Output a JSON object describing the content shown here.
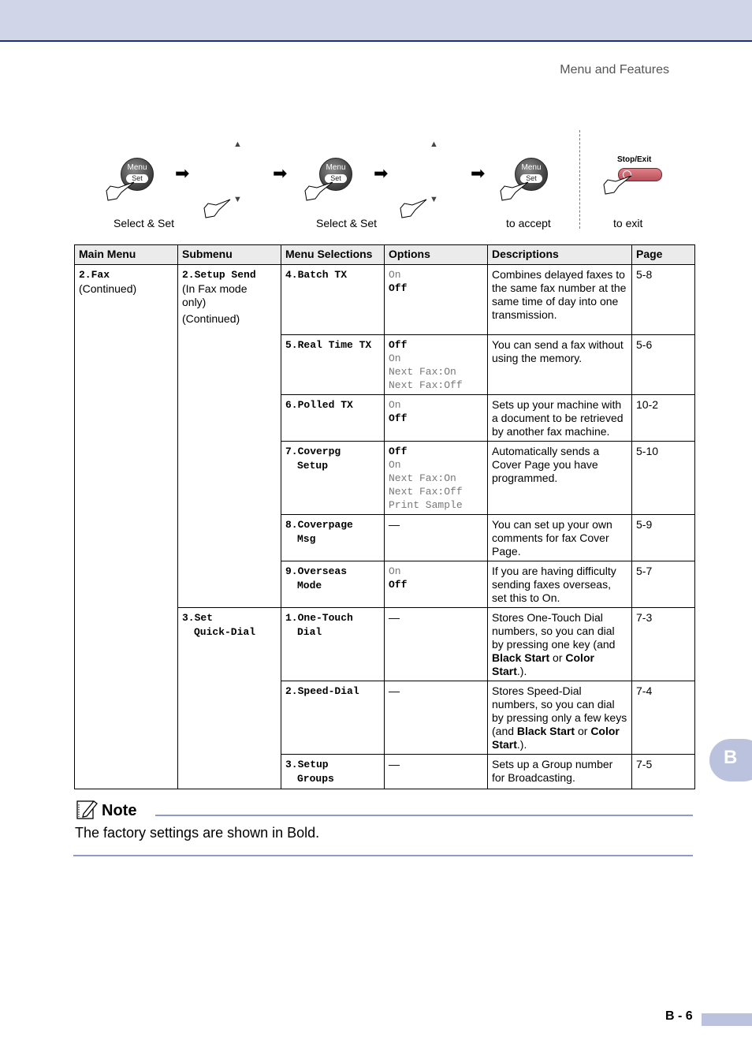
{
  "header": {
    "section_title": "Menu and Features",
    "accent_color": "#1b2f86",
    "band_color": "#d0d6e8"
  },
  "diagram": {
    "menu_button": {
      "top": "Menu",
      "bottom": "Set"
    },
    "steps": [
      {
        "caption": "Select & Set"
      },
      {
        "caption": "Select & Set"
      },
      {
        "caption": "to accept"
      },
      {
        "caption": "to exit"
      }
    ],
    "stop_label": "Stop/Exit",
    "up_icon": "▲",
    "down_icon": "▼",
    "arrow_icon": "➡"
  },
  "table": {
    "headers": [
      "Main Menu",
      "Submenu",
      "Menu Selections",
      "Options",
      "Descriptions",
      "Page"
    ],
    "main_menu": {
      "code_num": "2.",
      "code_label": "Fax",
      "note": "(Continued)"
    },
    "submenus": [
      {
        "code_num": "2.",
        "code_label": "Setup Send",
        "lines": [
          "(In Fax mode only)",
          "(Continued)"
        ]
      },
      {
        "code_num": "3.",
        "code_label": "Set",
        "code_label2": "Quick-Dial"
      }
    ],
    "rows": [
      {
        "sel_num": "4.",
        "sel_l1": "Batch TX",
        "sel_l2": "",
        "options": [
          {
            "t": "On",
            "b": false
          },
          {
            "t": "Off",
            "b": true
          }
        ],
        "desc": "Combines delayed faxes to the same fax number at the same time of day into one transmission.",
        "page": "5-8"
      },
      {
        "sel_num": "5.",
        "sel_l1": "Real Time TX",
        "sel_l2": "",
        "options": [
          {
            "t": "Off",
            "b": true
          },
          {
            "t": "On",
            "b": false
          },
          {
            "t": "Next Fax:On",
            "b": false
          },
          {
            "t": "Next Fax:Off",
            "b": false
          }
        ],
        "desc": "You can send a fax without using the memory.",
        "page": "5-6"
      },
      {
        "sel_num": "6.",
        "sel_l1": "Polled TX",
        "sel_l2": "",
        "options": [
          {
            "t": "On",
            "b": false
          },
          {
            "t": "Off",
            "b": true
          }
        ],
        "desc": "Sets up your machine with a document to be retrieved by another fax machine.",
        "page": "10-2"
      },
      {
        "sel_num": "7.",
        "sel_l1": "Coverpg",
        "sel_l2": "Setup",
        "options": [
          {
            "t": "Off",
            "b": true
          },
          {
            "t": "On",
            "b": false
          },
          {
            "t": "Next Fax:On",
            "b": false
          },
          {
            "t": "Next Fax:Off",
            "b": false
          },
          {
            "t": "Print Sample",
            "b": false
          }
        ],
        "desc": "Automatically sends a Cover Page you have programmed.",
        "page": "5-10"
      },
      {
        "sel_num": "8.",
        "sel_l1": "Coverpage",
        "sel_l2": "Msg",
        "options": [
          {
            "t": "—",
            "b": false,
            "dash": true
          }
        ],
        "desc": "You can set up your own comments for fax Cover Page.",
        "page": "5-9"
      },
      {
        "sel_num": "9.",
        "sel_l1": "Overseas",
        "sel_l2": "Mode",
        "options": [
          {
            "t": "On",
            "b": false
          },
          {
            "t": "Off",
            "b": true
          }
        ],
        "desc": "If you are having difficulty sending faxes overseas, set this to On.",
        "page": "5-7"
      },
      {
        "sel_num": "1.",
        "sel_l1": "One-Touch",
        "sel_l2": "Dial",
        "options": [
          {
            "t": "—",
            "b": false,
            "dash": true
          }
        ],
        "desc_parts": [
          {
            "t": "Stores One-Touch Dial numbers, so you can dial by pressing one key (and ",
            "b": false
          },
          {
            "t": "Black Start",
            "b": true
          },
          {
            "t": " or ",
            "b": false
          },
          {
            "t": "Color Start",
            "b": true
          },
          {
            "t": ".).",
            "b": false
          }
        ],
        "page": "7-3"
      },
      {
        "sel_num": "2.",
        "sel_l1": "Speed-Dial",
        "sel_l2": "",
        "options": [
          {
            "t": "—",
            "b": false,
            "dash": true
          }
        ],
        "desc_parts": [
          {
            "t": "Stores Speed-Dial numbers, so you can dial by pressing only a few keys (and ",
            "b": false
          },
          {
            "t": "Black Start",
            "b": true
          },
          {
            "t": " or ",
            "b": false
          },
          {
            "t": "Color Start",
            "b": true
          },
          {
            "t": ".).",
            "b": false
          }
        ],
        "page": "7-4"
      },
      {
        "sel_num": "3.",
        "sel_l1": "Setup",
        "sel_l2": "Groups",
        "options": [
          {
            "t": "—",
            "b": false,
            "dash": true
          }
        ],
        "desc": "Sets up a Group number for Broadcasting.",
        "page": "7-5"
      }
    ]
  },
  "note": {
    "title": "Note",
    "text": "The factory settings are shown in Bold."
  },
  "side_tab": {
    "label": "B"
  },
  "footer": {
    "page_number": "B - 6"
  }
}
